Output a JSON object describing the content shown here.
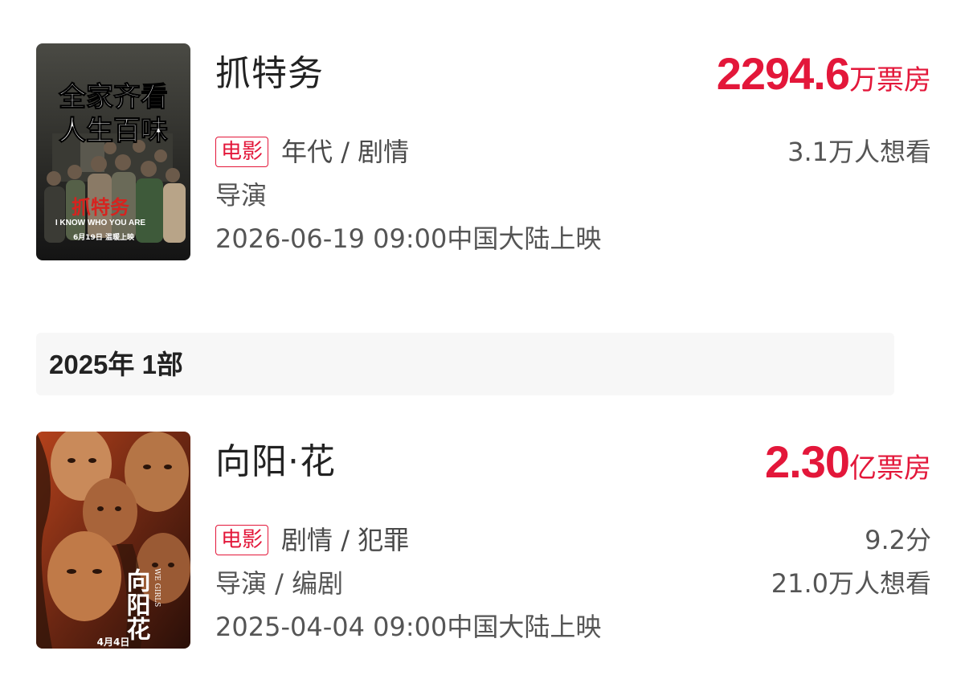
{
  "movies": [
    {
      "title": "抓特务",
      "box_office_value": "2294.6",
      "box_office_unit": "万票房",
      "type_tag": "电影",
      "genres": "年代 / 剧情",
      "roles": "导演",
      "release": "2026-06-19 09:00中国大陆上映",
      "score": "",
      "want_to_see": "3.1万人想看",
      "poster": {
        "headline_1": "全家齐看",
        "headline_2": "人生百味",
        "logo_text": "抓特务",
        "english": "I KNOW WHO YOU ARE",
        "date_text": "6月19日 温暖上映"
      }
    },
    {
      "title": "向阳·花",
      "box_office_value": "2.30",
      "box_office_unit": "亿票房",
      "type_tag": "电影",
      "genres": "剧情 / 犯罪",
      "roles": "导演 / 编剧",
      "release": "2025-04-04 09:00中国大陆上映",
      "score": "9.2分",
      "want_to_see": "21.0万人想看",
      "poster": {
        "logo_text": "向阳花",
        "english": "WE GIRLS",
        "date_text": "4月4日"
      }
    }
  ],
  "year_section": {
    "label": "2025年  1部"
  },
  "colors": {
    "accent": "#e3173a",
    "text_primary": "#222222",
    "text_secondary": "#555555",
    "section_bg": "#f7f7f7"
  }
}
